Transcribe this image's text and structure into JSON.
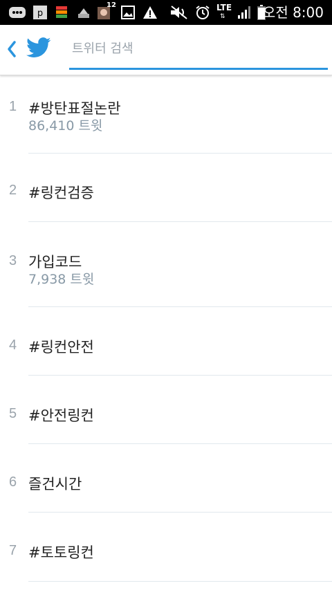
{
  "status_bar": {
    "time": "오전 8:00",
    "network": "LTE",
    "notification_count": "12",
    "icons": [
      "bbm-icon",
      "messenger-icon",
      "app-icon",
      "cleaner-icon",
      "avatar-icon",
      "gallery-icon",
      "warning-icon",
      "mute-icon",
      "alarm-icon",
      "lte-icon",
      "signal-icon",
      "battery-icon"
    ]
  },
  "header": {
    "search_placeholder": "트위터 검색",
    "accent_color": "#2b95de"
  },
  "trends": [
    {
      "rank": "1",
      "name": "#방탄표절논란",
      "count": "86,410 트윗"
    },
    {
      "rank": "2",
      "name": "#링컨검증",
      "count": ""
    },
    {
      "rank": "3",
      "name": "가입코드",
      "count": "7,938 트윗"
    },
    {
      "rank": "4",
      "name": "#링컨안전",
      "count": ""
    },
    {
      "rank": "5",
      "name": "#안전링컨",
      "count": ""
    },
    {
      "rank": "6",
      "name": "즐건시간",
      "count": ""
    },
    {
      "rank": "7",
      "name": "#토토링컨",
      "count": ""
    }
  ]
}
